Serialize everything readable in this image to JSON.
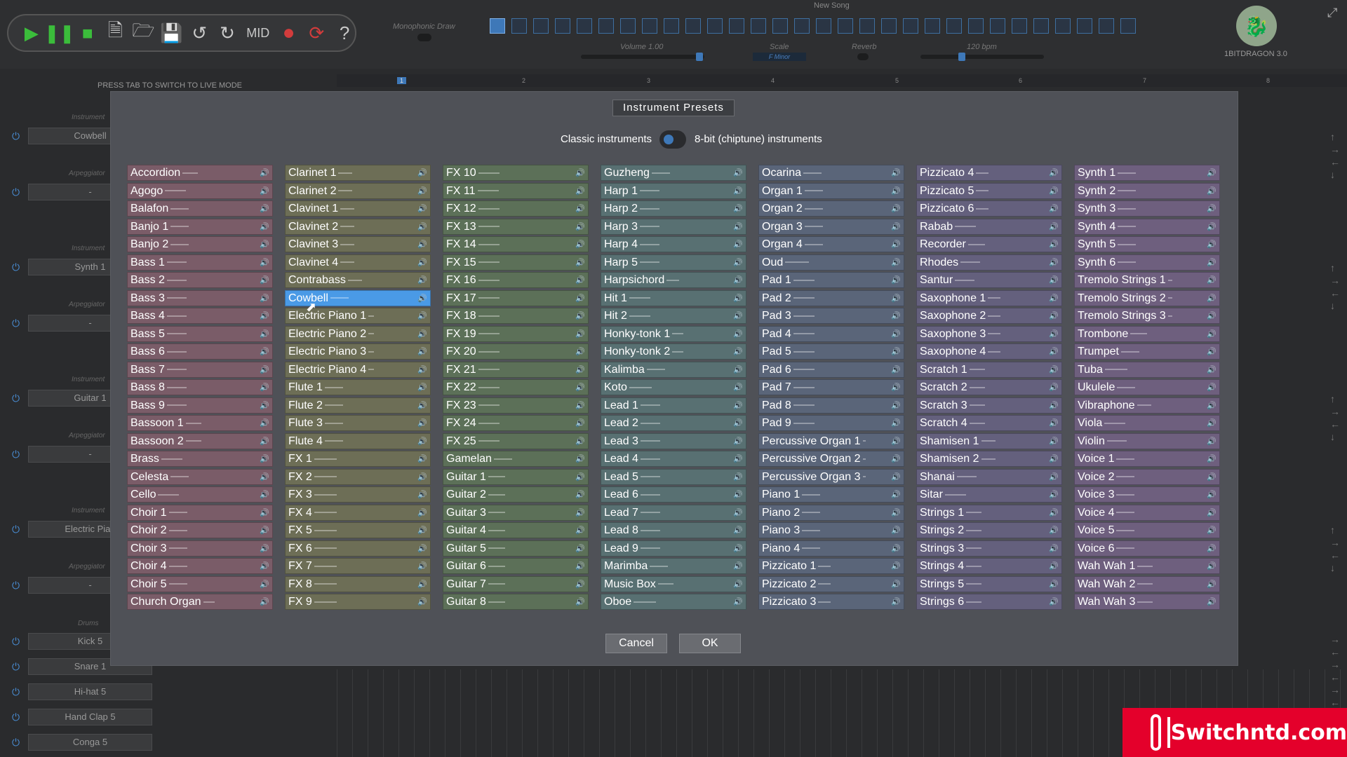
{
  "toolbar": {
    "mid_label": "MID",
    "monophonic_label": "Monophonic Draw",
    "song_title": "New Song",
    "volume_label": "Volume 1.00",
    "scale_label": "Scale",
    "scale_value": "F Minor",
    "reverb_label": "Reverb",
    "tempo_label": "120 bpm",
    "version": "1BITDRAGON 3.0",
    "tab_hint": "PRESS TAB TO SWITCH TO LIVE MODE"
  },
  "timeline": [
    "1",
    "2",
    "3",
    "4",
    "5",
    "6",
    "7",
    "8"
  ],
  "tracks": [
    {
      "label": "Instrument",
      "name": "Cowbell",
      "arp_label": "Arpeggiator",
      "arp": "-"
    },
    {
      "label": "Instrument",
      "name": "Synth 1",
      "arp_label": "Arpeggiator",
      "arp": "-"
    },
    {
      "label": "Instrument",
      "name": "Guitar 1",
      "arp_label": "Arpeggiator",
      "arp": "-"
    },
    {
      "label": "Instrument",
      "name": "Electric Pian",
      "arp_label": "Arpeggiator",
      "arp": "-"
    }
  ],
  "drums": {
    "label": "Drums",
    "items": [
      "Kick 5",
      "Snare 1",
      "Hi-hat 5",
      "Hand Clap 5",
      "Conga 5"
    ]
  },
  "modal": {
    "title": "Instrument Presets",
    "mode_left": "Classic instruments",
    "mode_right": "8-bit (chiptune) instruments",
    "cancel": "Cancel",
    "ok": "OK",
    "selected": "Cowbell",
    "columns": [
      {
        "color": "#7a5c68",
        "items": [
          "Accordion",
          "Agogo",
          "Balafon",
          "Banjo 1",
          "Banjo 2",
          "Bass 1",
          "Bass 2",
          "Bass 3",
          "Bass 4",
          "Bass 5",
          "Bass 6",
          "Bass 7",
          "Bass 8",
          "Bass 9",
          "Bassoon 1",
          "Bassoon 2",
          "Brass",
          "Celesta",
          "Cello",
          "Choir 1",
          "Choir 2",
          "Choir 3",
          "Choir 4",
          "Choir 5",
          "Church Organ"
        ]
      },
      {
        "color": "#6d6e56",
        "items": [
          "Clarinet 1",
          "Clarinet 2",
          "Clavinet 1",
          "Clavinet 2",
          "Clavinet 3",
          "Clavinet 4",
          "Contrabass",
          "Cowbell",
          "Electric Piano 1",
          "Electric Piano 2",
          "Electric Piano 3",
          "Electric Piano 4",
          "Flute 1",
          "Flute 2",
          "Flute 3",
          "Flute 4",
          "FX 1",
          "FX 2",
          "FX 3",
          "FX 4",
          "FX 5",
          "FX 6",
          "FX 7",
          "FX 8",
          "FX 9"
        ]
      },
      {
        "color": "#5c7058",
        "items": [
          "FX 10",
          "FX 11",
          "FX 12",
          "FX 13",
          "FX 14",
          "FX 15",
          "FX 16",
          "FX 17",
          "FX 18",
          "FX 19",
          "FX 20",
          "FX 21",
          "FX 22",
          "FX 23",
          "FX 24",
          "FX 25",
          "Gamelan",
          "Guitar 1",
          "Guitar 2",
          "Guitar 3",
          "Guitar 4",
          "Guitar 5",
          "Guitar 6",
          "Guitar 7",
          "Guitar 8"
        ]
      },
      {
        "color": "#587072",
        "items": [
          "Guzheng",
          "Harp 1",
          "Harp 2",
          "Harp 3",
          "Harp 4",
          "Harp 5",
          "Harpsichord",
          "Hit 1",
          "Hit 2",
          "Honky-tonk 1",
          "Honky-tonk 2",
          "Kalimba",
          "Koto",
          "Lead 1",
          "Lead 2",
          "Lead 3",
          "Lead 4",
          "Lead 5",
          "Lead 6",
          "Lead 7",
          "Lead 8",
          "Lead 9",
          "Marimba",
          "Music Box",
          "Oboe"
        ]
      },
      {
        "color": "#5a6579",
        "items": [
          "Ocarina",
          "Organ 1",
          "Organ 2",
          "Organ 3",
          "Organ 4",
          "Oud",
          "Pad 1",
          "Pad 2",
          "Pad 3",
          "Pad 4",
          "Pad 5",
          "Pad 6",
          "Pad 7",
          "Pad 8",
          "Pad 9",
          "Percussive Organ 1",
          "Percussive Organ 2",
          "Percussive Organ 3",
          "Piano 1",
          "Piano 2",
          "Piano 3",
          "Piano 4",
          "Pizzicato 1",
          "Pizzicato 2",
          "Pizzicato 3"
        ]
      },
      {
        "color": "#64607d",
        "items": [
          "Pizzicato 4",
          "Pizzicato 5",
          "Pizzicato 6",
          "Rabab",
          "Recorder",
          "Rhodes",
          "Santur",
          "Saxophone 1",
          "Saxophone 2",
          "Saxophone 3",
          "Saxophone 4",
          "Scratch 1",
          "Scratch 2",
          "Scratch 3",
          "Scratch 4",
          "Shamisen 1",
          "Shamisen 2",
          "Shanai",
          "Sitar",
          "Strings 1",
          "Strings 2",
          "Strings 3",
          "Strings 4",
          "Strings 5",
          "Strings 6"
        ]
      },
      {
        "color": "#6e5f7e",
        "items": [
          "Synth 1",
          "Synth 2",
          "Synth 3",
          "Synth 4",
          "Synth 5",
          "Synth 6",
          "Tremolo Strings 1",
          "Tremolo Strings 2",
          "Tremolo Strings 3",
          "Trombone",
          "Trumpet",
          "Tuba",
          "Ukulele",
          "Vibraphone",
          "Viola",
          "Violin",
          "Voice 1",
          "Voice 2",
          "Voice 3",
          "Voice 4",
          "Voice 5",
          "Voice 6",
          "Wah Wah 1",
          "Wah Wah 2",
          "Wah Wah 3"
        ]
      }
    ]
  },
  "watermark": "Switchntd.com"
}
